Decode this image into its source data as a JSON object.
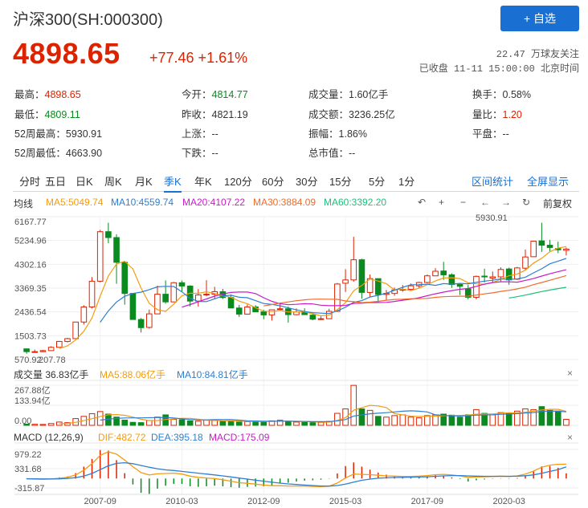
{
  "header": {
    "title": "沪深300(SH:000300)",
    "follow_label": "+ 自选",
    "price": "4898.65",
    "change": "+77.46 +1.61%",
    "followers": "22.47 万球友关注",
    "status": "已收盘 11-11 15:00:00 北京时间"
  },
  "stats": {
    "high_label": "最高：",
    "high": "4898.65",
    "low_label": "最低：",
    "low": "4809.11",
    "w52_high_label": "52周最高：",
    "w52_high": "5930.91",
    "w52_low_label": "52周最低：",
    "w52_low": "4663.90",
    "open_label": "今开：",
    "open": "4814.77",
    "prev_label": "昨收：",
    "prev": "4821.19",
    "up_label": "上涨：",
    "up": "--",
    "down_label": "下跌：",
    "down": "--",
    "vol_label": "成交量：",
    "vol": "1.60亿手",
    "amt_label": "成交额：",
    "amt": "3236.25亿",
    "amp_label": "振幅：",
    "amp": "1.86%",
    "mcap_label": "总市值：",
    "mcap": "--",
    "turnover_label": "换手：",
    "turnover": "0.58%",
    "ratio_label": "量比：",
    "ratio": "1.20",
    "flat_label": "平盘：",
    "flat": "--"
  },
  "tabs": [
    "分时",
    "五日",
    "日K",
    "周K",
    "月K",
    "季K",
    "年K",
    "120分",
    "60分",
    "30分",
    "15分",
    "5分",
    "1分"
  ],
  "active_tab": "季K",
  "links": {
    "interval": "区间统计",
    "fullscreen": "全屏显示"
  },
  "ma_bar": {
    "label": "均线",
    "ma5": "MA5:5049.74",
    "ma10": "MA10:4559.74",
    "ma20": "MA20:4107.22",
    "ma30": "MA30:3884.09",
    "ma60": "MA60:3392.20",
    "restore": "前复权"
  },
  "colors": {
    "up": "#dd2200",
    "down": "#0a8a1f",
    "ma5": "#f39c12",
    "ma10": "#2f7fd1",
    "ma20": "#c81cc8",
    "ma30": "#ef6c2c",
    "ma60": "#1fbf7a",
    "accent": "#1a6fd3"
  },
  "kline": {
    "y_ticks": [
      "6167.77",
      "5234.96",
      "4302.16",
      "3369.35",
      "2436.54",
      "1503.73",
      "570.92"
    ],
    "max_label": "5930.91",
    "min_label": "207.78"
  },
  "volume": {
    "header": "成交量 36.83亿手",
    "ma5": "MA5:88.06亿手",
    "ma10": "MA10:84.81亿手",
    "y_ticks": [
      "267.88亿",
      "133.94亿",
      "0.00"
    ]
  },
  "macd": {
    "header": "MACD (12,26,9)",
    "dif": "DIF:482.72",
    "dea": "DEA:395.18",
    "macd": "MACD:175.09",
    "y_ticks": [
      "979.22",
      "331.68",
      "-315.87"
    ]
  },
  "x_ticks": [
    "2007-09",
    "2010-03",
    "2012-09",
    "2015-03",
    "2017-09",
    "2020-03"
  ],
  "chart_data": {
    "type": "candlestick",
    "x": [
      "2005-Q2",
      "2005-Q3",
      "2005-Q4",
      "2006-Q1",
      "2006-Q2",
      "2006-Q3",
      "2006-Q4",
      "2007-Q1",
      "2007-Q2",
      "2007-Q3",
      "2007-Q4",
      "2008-Q1",
      "2008-Q2",
      "2008-Q3",
      "2008-Q4",
      "2009-Q1",
      "2009-Q2",
      "2009-Q3",
      "2009-Q4",
      "2010-Q1",
      "2010-Q2",
      "2010-Q3",
      "2010-Q4",
      "2011-Q1",
      "2011-Q2",
      "2011-Q3",
      "2011-Q4",
      "2012-Q1",
      "2012-Q2",
      "2012-Q3",
      "2012-Q4",
      "2013-Q1",
      "2013-Q2",
      "2013-Q3",
      "2013-Q4",
      "2014-Q1",
      "2014-Q2",
      "2014-Q3",
      "2014-Q4",
      "2015-Q1",
      "2015-Q2",
      "2015-Q3",
      "2015-Q4",
      "2016-Q1",
      "2016-Q2",
      "2016-Q3",
      "2016-Q4",
      "2017-Q1",
      "2017-Q2",
      "2017-Q3",
      "2017-Q4",
      "2018-Q1",
      "2018-Q2",
      "2018-Q3",
      "2018-Q4",
      "2019-Q1",
      "2019-Q2",
      "2019-Q3",
      "2019-Q4",
      "2020-Q1",
      "2020-Q2",
      "2020-Q3",
      "2020-Q4",
      "2021-Q1",
      "2021-Q2",
      "2021-Q3",
      "2021-Q4"
    ],
    "open": [
      990,
      880,
      880,
      920,
      1050,
      1280,
      1390,
      2040,
      2630,
      3640,
      5580,
      5350,
      4380,
      3160,
      2140,
      1830,
      2360,
      3130,
      2830,
      3580,
      3450,
      2860,
      3100,
      3130,
      3230,
      3000,
      2590,
      2350,
      2630,
      2440,
      2320,
      2540,
      2560,
      2330,
      2440,
      2310,
      2160,
      2170,
      2460,
      3560,
      3690,
      4480,
      3200,
      3740,
      3120,
      3160,
      3300,
      3320,
      3460,
      3590,
      3850,
      4040,
      3890,
      3510,
      3340,
      3010,
      3840,
      3760,
      3810,
      4120,
      3720,
      4150,
      4600,
      5220,
      5050,
      4920,
      4850
    ],
    "high": [
      1000,
      960,
      950,
      1090,
      1300,
      1420,
      2040,
      2700,
      3800,
      5650,
      5930,
      5480,
      4390,
      3170,
      2200,
      2530,
      3470,
      3670,
      3610,
      3660,
      3480,
      3330,
      3680,
      3420,
      3340,
      3120,
      2710,
      2730,
      2700,
      2520,
      2510,
      2800,
      2650,
      2570,
      2580,
      2380,
      2260,
      2560,
      3570,
      4110,
      5380,
      4520,
      3900,
      3740,
      3300,
      3390,
      3490,
      3550,
      3620,
      3900,
      4150,
      4400,
      3950,
      3550,
      3500,
      3860,
      4130,
      4020,
      4180,
      4170,
      4200,
      4880,
      5150,
      5930,
      5260,
      5190,
      4960
    ],
    "low": [
      800,
      840,
      860,
      910,
      1040,
      1240,
      1380,
      1940,
      2570,
      3600,
      5130,
      3540,
      2720,
      2140,
      1630,
      1780,
      2350,
      2760,
      2830,
      3240,
      2650,
      2640,
      3050,
      2950,
      2940,
      2600,
      2240,
      2340,
      2450,
      2150,
      2100,
      2480,
      2020,
      2310,
      2340,
      2110,
      2120,
      2170,
      2440,
      3220,
      3620,
      2950,
      3030,
      2810,
      2900,
      3070,
      3230,
      3270,
      3380,
      3560,
      3840,
      3690,
      3380,
      3100,
      2930,
      2930,
      3590,
      3590,
      3640,
      3500,
      3690,
      4090,
      4600,
      4790,
      4800,
      4740,
      4650
    ],
    "close": [
      880,
      880,
      920,
      1050,
      1280,
      1390,
      2040,
      2630,
      3640,
      5580,
      5350,
      4380,
      3160,
      2140,
      1820,
      2360,
      3130,
      2830,
      3580,
      3450,
      2860,
      3100,
      3130,
      3230,
      3000,
      2590,
      2350,
      2630,
      2440,
      2320,
      2520,
      2560,
      2330,
      2440,
      2330,
      2150,
      2170,
      2460,
      3530,
      3690,
      4480,
      3200,
      3740,
      3120,
      3160,
      3300,
      3320,
      3460,
      3590,
      3850,
      4030,
      3890,
      3510,
      3440,
      3010,
      3830,
      3830,
      3810,
      4100,
      3690,
      4160,
      4590,
      5210,
      5050,
      4960,
      4870,
      4900
    ],
    "volume": [
      8,
      7,
      6,
      12,
      22,
      18,
      45,
      60,
      78,
      92,
      75,
      55,
      35,
      20,
      18,
      32,
      55,
      70,
      40,
      38,
      30,
      28,
      35,
      32,
      28,
      26,
      22,
      24,
      28,
      25,
      30,
      34,
      26,
      22,
      20,
      18,
      20,
      26,
      80,
      110,
      267,
      110,
      100,
      60,
      55,
      65,
      70,
      55,
      50,
      65,
      70,
      75,
      68,
      55,
      70,
      105,
      80,
      70,
      85,
      80,
      95,
      110,
      105,
      125,
      100,
      95,
      40
    ],
    "dif": [
      -10,
      -20,
      -25,
      -15,
      10,
      40,
      120,
      280,
      500,
      780,
      900,
      820,
      620,
      400,
      200,
      120,
      160,
      170,
      180,
      150,
      80,
      40,
      20,
      0,
      -40,
      -90,
      -140,
      -160,
      -190,
      -220,
      -240,
      -240,
      -250,
      -250,
      -255,
      -265,
      -270,
      -260,
      -150,
      20,
      150,
      140,
      130,
      110,
      90,
      80,
      70,
      70,
      80,
      100,
      130,
      140,
      120,
      90,
      40,
      50,
      60,
      70,
      80,
      70,
      90,
      150,
      250,
      380,
      450,
      480,
      483
    ],
    "dea": [
      -5,
      -10,
      -15,
      -15,
      -10,
      5,
      30,
      80,
      170,
      300,
      430,
      510,
      530,
      500,
      440,
      380,
      330,
      290,
      270,
      240,
      210,
      180,
      150,
      120,
      90,
      55,
      15,
      -20,
      -55,
      -90,
      -125,
      -155,
      -180,
      -200,
      -220,
      -235,
      -250,
      -255,
      -235,
      -190,
      -120,
      -60,
      -20,
      10,
      25,
      35,
      40,
      45,
      50,
      60,
      75,
      90,
      100,
      100,
      90,
      80,
      75,
      75,
      75,
      75,
      80,
      95,
      125,
      175,
      240,
      300,
      395
    ],
    "macd": [
      -10,
      -20,
      -20,
      0,
      40,
      70,
      180,
      400,
      660,
      960,
      940,
      620,
      180,
      -200,
      -480,
      -520,
      -340,
      -240,
      -180,
      -180,
      -260,
      -280,
      -260,
      -240,
      -260,
      -290,
      -310,
      -280,
      -270,
      -260,
      -230,
      -170,
      -140,
      -100,
      -70,
      -60,
      -40,
      -10,
      170,
      420,
      540,
      400,
      300,
      200,
      130,
      90,
      60,
      50,
      60,
      80,
      110,
      100,
      40,
      -20,
      -100,
      -60,
      -30,
      -10,
      10,
      -10,
      20,
      110,
      250,
      410,
      420,
      360,
      175
    ],
    "ma5_line": "MA5:5049.74",
    "ma10_line": "MA10:4559.74",
    "ma20_line": "MA20:4107.22",
    "ma30_line": "MA30:3884.09",
    "ma60_line": "MA60:3392.20",
    "ylim": [
      570.92,
      6167.77
    ]
  }
}
